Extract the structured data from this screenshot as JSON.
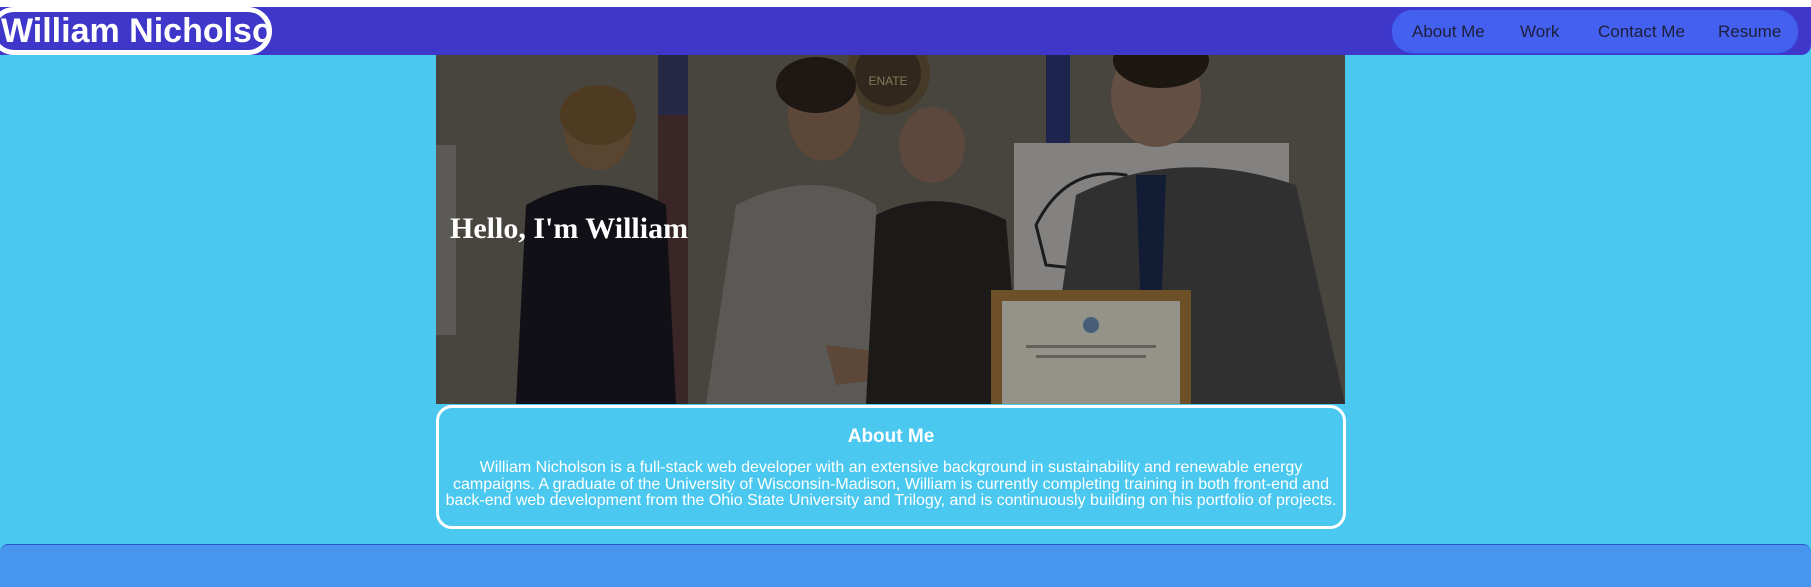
{
  "header": {
    "site_title": "William Nicholson",
    "nav": [
      "About Me",
      "Work",
      "Contact Me",
      "Resume"
    ]
  },
  "hero": {
    "title": "Hello, I'm William"
  },
  "about": {
    "title": "About Me",
    "body": "William Nicholson is a full-stack web developer with an extensive background in sustainability and renewable energy campaigns. A graduate of the University of Wisconsin-Madison, William is currently completing training in both front-end and back-end web development from the Ohio State University and Trilogy, and is continuously building on his portfolio of projects."
  },
  "colors": {
    "page_background": "#4ac8ef",
    "header_background": "#3f37c9",
    "nav_background": "#4361ee",
    "footer_background": "#4895ef",
    "text_light": "#ffffff"
  }
}
